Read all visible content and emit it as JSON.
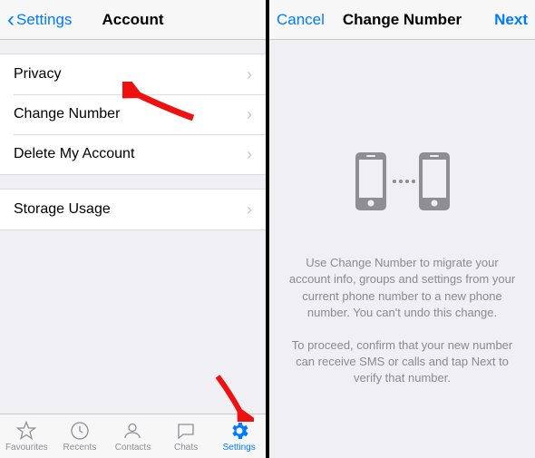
{
  "colors": {
    "tint": "#007aff",
    "gray": "#8e8e93"
  },
  "left": {
    "nav": {
      "back": "Settings",
      "title": "Account"
    },
    "group1": [
      {
        "label": "Privacy"
      },
      {
        "label": "Change Number"
      },
      {
        "label": "Delete My Account"
      }
    ],
    "group2": [
      {
        "label": "Storage Usage"
      }
    ],
    "tabs": [
      {
        "label": "Favourites"
      },
      {
        "label": "Recents"
      },
      {
        "label": "Contacts"
      },
      {
        "label": "Chats"
      },
      {
        "label": "Settings",
        "active": true
      }
    ]
  },
  "right": {
    "nav": {
      "cancel": "Cancel",
      "title": "Change Number",
      "next": "Next"
    },
    "body": {
      "p1": "Use Change Number to migrate your account info, groups and settings from your current phone number to a new phone number. You can't undo this change.",
      "p2": "To proceed, confirm that your new number can receive SMS or calls and tap Next to verify that number."
    }
  }
}
